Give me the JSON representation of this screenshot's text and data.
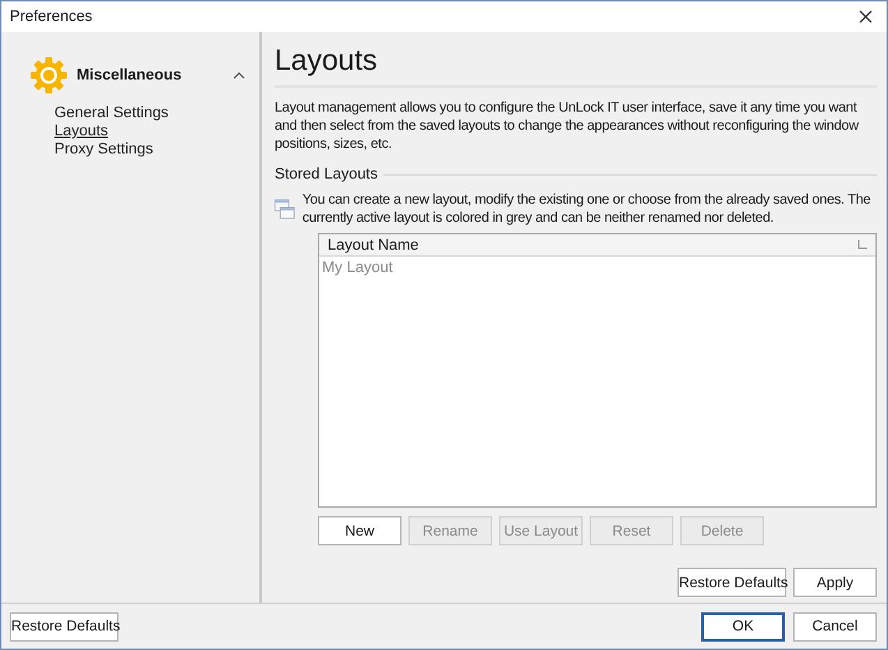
{
  "window": {
    "title": "Preferences"
  },
  "sidebar": {
    "group": {
      "label": "Miscellaneous",
      "expanded": true
    },
    "items": [
      {
        "label": "General Settings",
        "selected": false
      },
      {
        "label": "Layouts",
        "selected": true
      },
      {
        "label": "Proxy Settings",
        "selected": false
      }
    ]
  },
  "page": {
    "title": "Layouts",
    "description": "Layout management allows you to configure the UnLock IT user interface, save it any time you want and then select from the saved layouts to change the appearances without reconfiguring the window positions, sizes, etc.",
    "section": "Stored Layouts",
    "hint": "You can create a new layout, modify the existing one or choose from the already saved ones. The currently active layout is colored in grey and can be neither renamed nor deleted.",
    "table": {
      "columns": [
        "Layout Name"
      ],
      "rows": [
        {
          "name": "My Layout",
          "active": true
        }
      ]
    },
    "buttons": [
      {
        "label": "New",
        "disabled": false
      },
      {
        "label": "Rename",
        "disabled": true
      },
      {
        "label": "Use Layout",
        "disabled": true
      },
      {
        "label": "Reset",
        "disabled": true
      },
      {
        "label": "Delete",
        "disabled": true
      }
    ],
    "actions": [
      "Restore Defaults",
      "Apply"
    ]
  },
  "footer": {
    "left": "Restore Defaults",
    "buttons": [
      {
        "label": "OK",
        "default": true
      },
      {
        "label": "Cancel",
        "default": false
      }
    ]
  }
}
